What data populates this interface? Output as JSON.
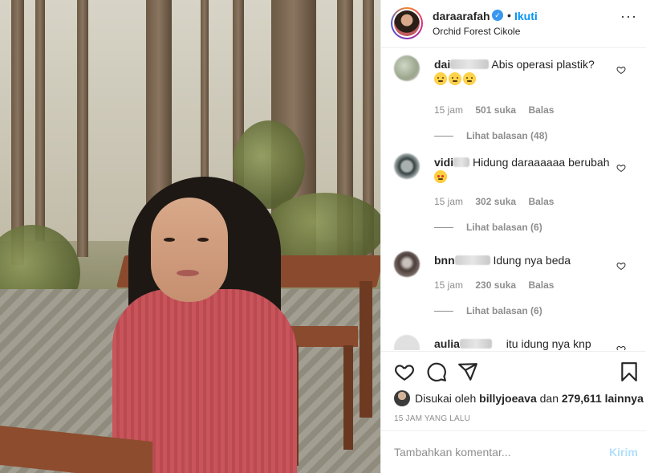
{
  "header": {
    "username": "daraarafah",
    "separator": "•",
    "follow_label": "Ikuti",
    "location": "Orchid Forest Cikole",
    "more_label": "···"
  },
  "comments": [
    {
      "username_visible": "dai",
      "text": "Abis operasi plastik?",
      "emoji_count": 3,
      "time": "15 jam",
      "likes": "501 suka",
      "reply_label": "Balas",
      "view_replies": "Lihat balasan (48)"
    },
    {
      "username_visible": "vidi",
      "text": "Hidung daraaaaaa berubah",
      "time": "15 jam",
      "likes": "302 suka",
      "reply_label": "Balas",
      "view_replies": "Lihat balasan (6)"
    },
    {
      "username_visible": "bnn",
      "text": "Idung nya beda",
      "time": "15 jam",
      "likes": "230 suka",
      "reply_label": "Balas",
      "view_replies": "Lihat balasan (6)"
    },
    {
      "username_visible": "aulia",
      "text": "itu idung nya knp"
    }
  ],
  "actions": {
    "liked_prefix": "Disukai oleh",
    "liked_user": "billyjoeava",
    "liked_conj": "dan",
    "liked_count": "279,611 lainnya",
    "timestamp": "15 JAM YANG LALU"
  },
  "add_comment": {
    "placeholder": "Tambahkan komentar...",
    "post_label": "Kirim"
  },
  "icons": [
    "verified-badge-icon",
    "more-options-icon",
    "heart-icon",
    "comment-icon",
    "share-icon",
    "bookmark-icon"
  ],
  "colors": {
    "accent": "#0095f6",
    "text": "#262626",
    "muted": "#8e8e8e",
    "post_disabled": "#b2dffc"
  }
}
